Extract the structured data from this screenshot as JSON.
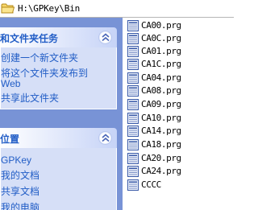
{
  "address_bar": {
    "path": "H:\\GPKey\\Bin",
    "icon": "folder-icon"
  },
  "task_pane": {
    "file_tasks": {
      "title": "和文件夹任务",
      "items": [
        {
          "label": "创建一个新文件夹"
        },
        {
          "label_line1": "将这个文件夹发布到",
          "label_line2": "Web"
        },
        {
          "label": "共享此文件夹"
        }
      ]
    },
    "places": {
      "title": "位置",
      "items": [
        {
          "label": "GPKey"
        },
        {
          "label": "我的文档"
        },
        {
          "label": "共享文档"
        },
        {
          "label": "我的电脑"
        }
      ]
    }
  },
  "files": [
    {
      "name": "CA00.prg",
      "icon": "prg-file-icon"
    },
    {
      "name": "CA0C.prg",
      "icon": "prg-file-icon"
    },
    {
      "name": "CA01.prg",
      "icon": "prg-file-icon"
    },
    {
      "name": "CA1C.prg",
      "icon": "prg-file-icon"
    },
    {
      "name": "CA04.prg",
      "icon": "prg-file-icon"
    },
    {
      "name": "CA08.prg",
      "icon": "prg-file-icon"
    },
    {
      "name": "CA09.prg",
      "icon": "prg-file-icon"
    },
    {
      "name": "CA10.prg",
      "icon": "prg-file-icon"
    },
    {
      "name": "CA14.prg",
      "icon": "prg-file-icon"
    },
    {
      "name": "CA18.prg",
      "icon": "prg-file-icon"
    },
    {
      "name": "CA20.prg",
      "icon": "prg-file-icon"
    },
    {
      "name": "CA24.prg",
      "icon": "prg-file-icon"
    },
    {
      "name": "CCCC",
      "icon": "generic-file-icon"
    }
  ],
  "colors": {
    "task_pane_background": "#7893d6",
    "panel_body": "#d6dff7",
    "link_text": "#215dc6"
  }
}
